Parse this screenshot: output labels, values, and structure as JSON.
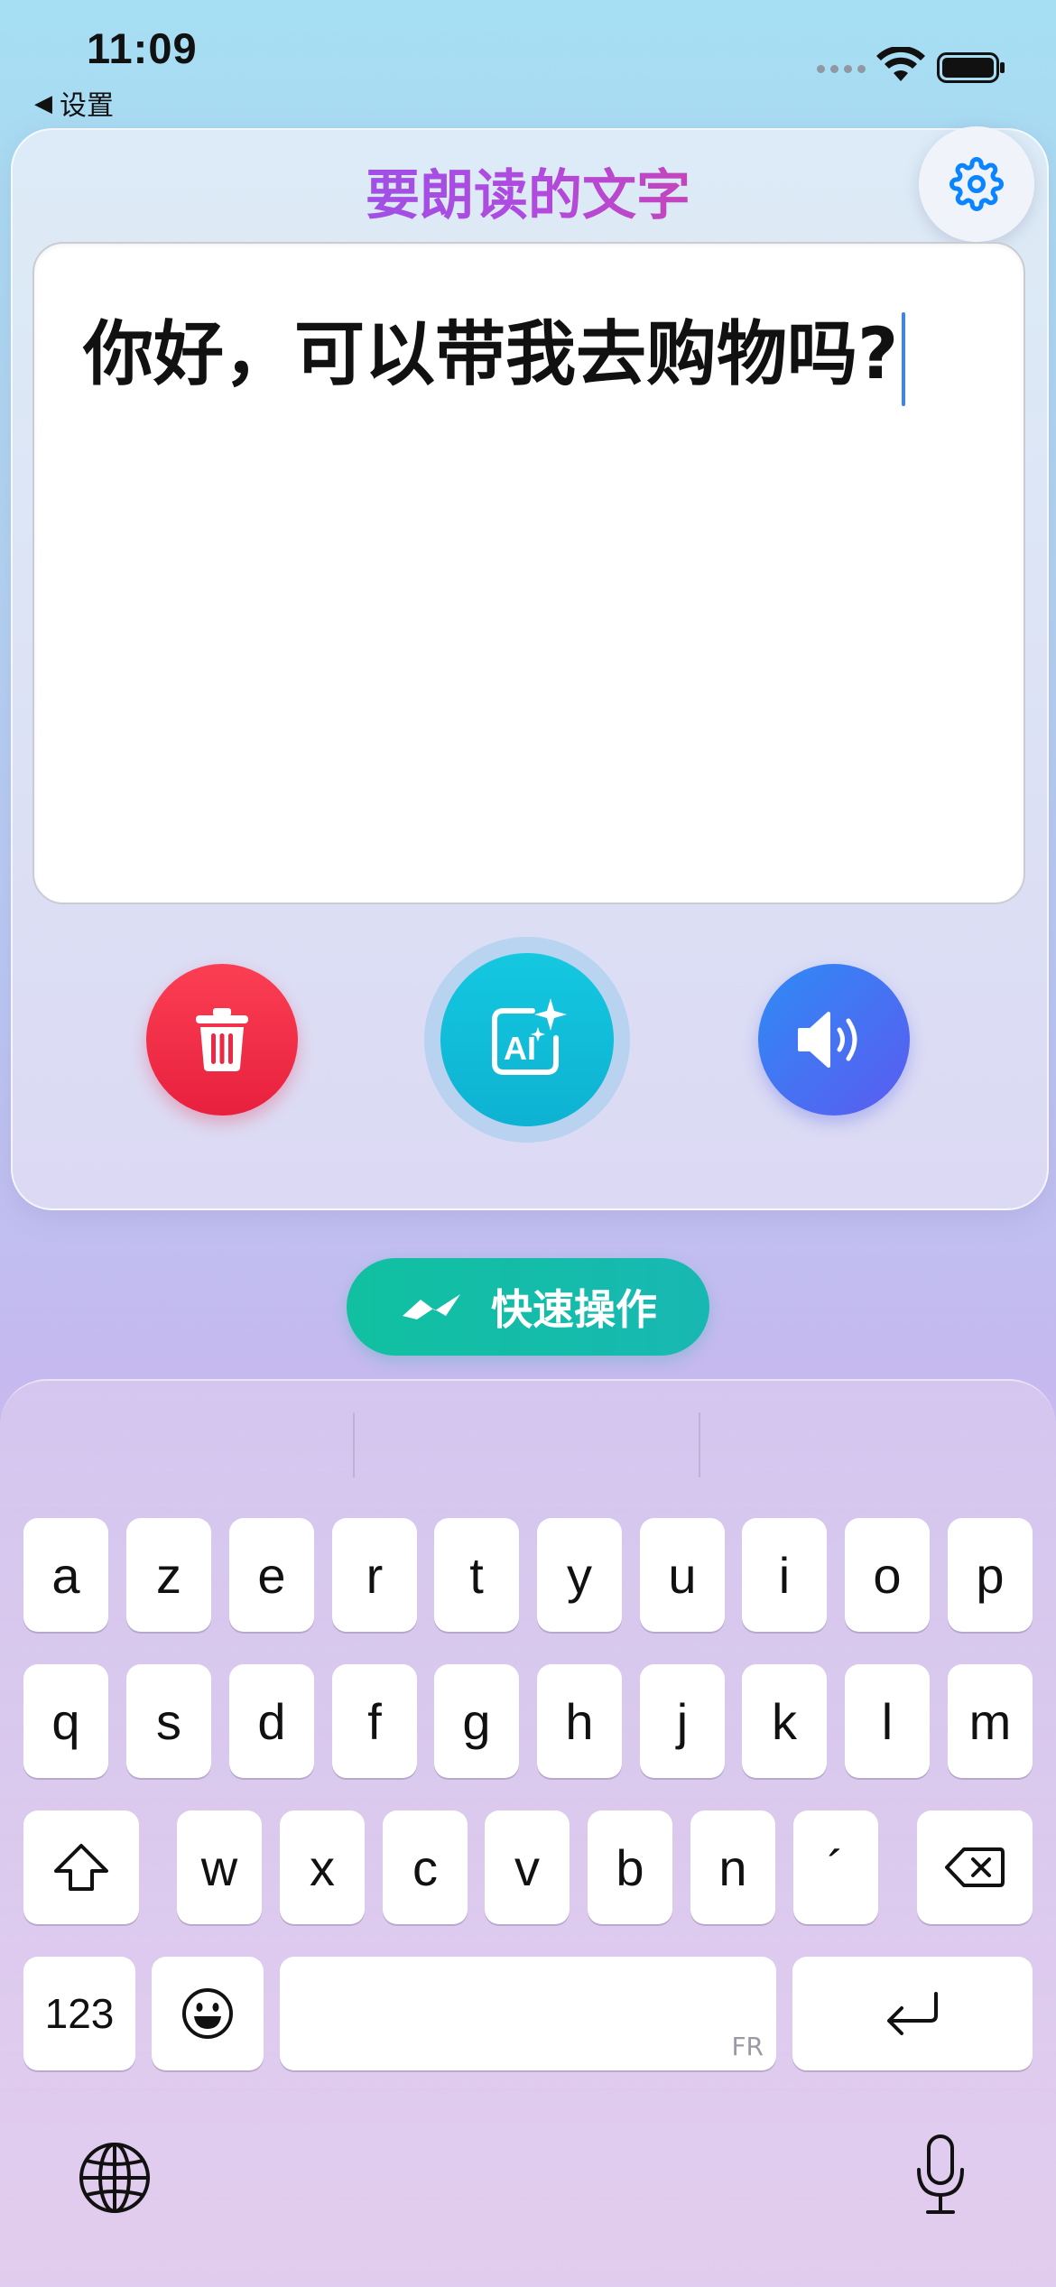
{
  "status_bar": {
    "time": "11:09",
    "back_label": "设置"
  },
  "card": {
    "title": "要朗读的文字",
    "text_value": "你好，可以带我去购物吗?"
  },
  "actions": {
    "quick_label": "快速操作"
  },
  "keyboard": {
    "row1": [
      "a",
      "z",
      "e",
      "r",
      "t",
      "y",
      "u",
      "i",
      "o",
      "p"
    ],
    "row2": [
      "q",
      "s",
      "d",
      "f",
      "g",
      "h",
      "j",
      "k",
      "l",
      "m"
    ],
    "row3": [
      "w",
      "x",
      "c",
      "v",
      "b",
      "n",
      "´"
    ],
    "numbers_label": "123",
    "space_lang": "FR"
  },
  "colors": {
    "delete": "#f02d4a",
    "ai": "#14c0dc",
    "speak": "#3f78f4",
    "quick": "#10bfa4",
    "accent": "#0a84ff"
  }
}
